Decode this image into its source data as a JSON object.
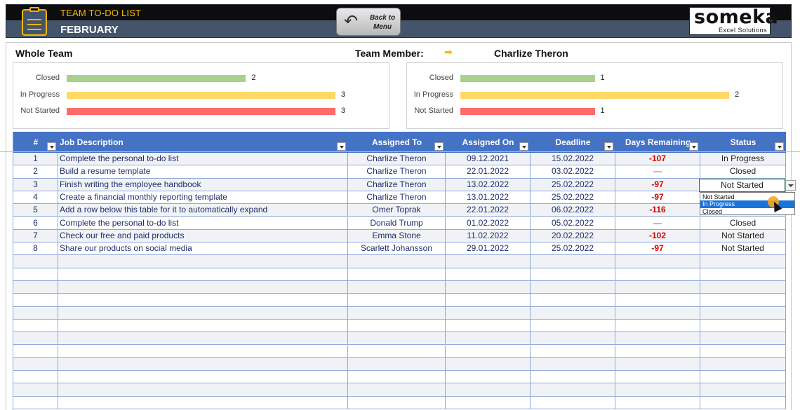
{
  "header": {
    "title": "TEAM TO-DO LIST",
    "month": "FEBRUARY",
    "back_button": "Back to Menu",
    "brand": "someka",
    "brand_sub": "Excel Solutions",
    "colors": {
      "accent": "#f5b800",
      "header_bg": "#44546a"
    }
  },
  "dashboard": {
    "whole_team_label": "Whole Team",
    "team_member_label": "Team Member:",
    "member_name": "Charlize Theron",
    "whole_team_chart": {
      "type": "bar",
      "categories": [
        "Closed",
        "In Progress",
        "Not Started"
      ],
      "values": [
        2,
        3,
        3
      ],
      "colors": [
        "#a9d18e",
        "#ffd966",
        "#ff6b6b"
      ]
    },
    "member_chart": {
      "type": "bar",
      "categories": [
        "Closed",
        "In Progress",
        "Not Started"
      ],
      "values": [
        1,
        2,
        1
      ],
      "colors": [
        "#a9d18e",
        "#ffd966",
        "#ff6b6b"
      ]
    }
  },
  "table": {
    "columns": [
      "#",
      "Job Description",
      "Assigned To",
      "Assigned On",
      "Deadline",
      "Days Remaining",
      "Status"
    ],
    "rows": [
      {
        "num": "1",
        "job": "Complete the personal to-do list",
        "assigned_to": "Charlize Theron",
        "assigned_on": "09.12.2021",
        "deadline": "15.02.2022",
        "days": "-107",
        "status": "In Progress"
      },
      {
        "num": "2",
        "job": "Build a resume template",
        "assigned_to": "Charlize Theron",
        "assigned_on": "22.01.2022",
        "deadline": "03.02.2022",
        "days": "—",
        "status": "Closed"
      },
      {
        "num": "3",
        "job": "Finish writing the employee handbook",
        "assigned_to": "Charlize Theron",
        "assigned_on": "13.02.2022",
        "deadline": "25.02.2022",
        "days": "-97",
        "status": "Not Started"
      },
      {
        "num": "4",
        "job": "Create a financial monthly reporting template",
        "assigned_to": "Charlize Theron",
        "assigned_on": "13.01.2022",
        "deadline": "25.02.2022",
        "days": "-97",
        "status": ""
      },
      {
        "num": "5",
        "job": "Add a row below this table for it to automatically expand",
        "assigned_to": "Omer Toprak",
        "assigned_on": "22.01.2022",
        "deadline": "06.02.2022",
        "days": "-116",
        "status": ""
      },
      {
        "num": "6",
        "job": "Complete the personal to-do list",
        "assigned_to": "Donald Trump",
        "assigned_on": "01.02.2022",
        "deadline": "05.02.2022",
        "days": "—",
        "status": "Closed"
      },
      {
        "num": "7",
        "job": "Check our free and paid products",
        "assigned_to": "Emma Stone",
        "assigned_on": "11.02.2022",
        "deadline": "20.02.2022",
        "days": "-102",
        "status": "Not Started"
      },
      {
        "num": "8",
        "job": "Share our products on social media",
        "assigned_to": "Scarlett Johansson",
        "assigned_on": "29.01.2022",
        "deadline": "25.02.2022",
        "days": "-97",
        "status": "Not Started"
      }
    ],
    "empty_rows": 12
  },
  "status_dropdown": {
    "current": "Not Started",
    "options": [
      "Not Started",
      "In Progress",
      "Closed"
    ],
    "highlighted": "In Progress"
  }
}
